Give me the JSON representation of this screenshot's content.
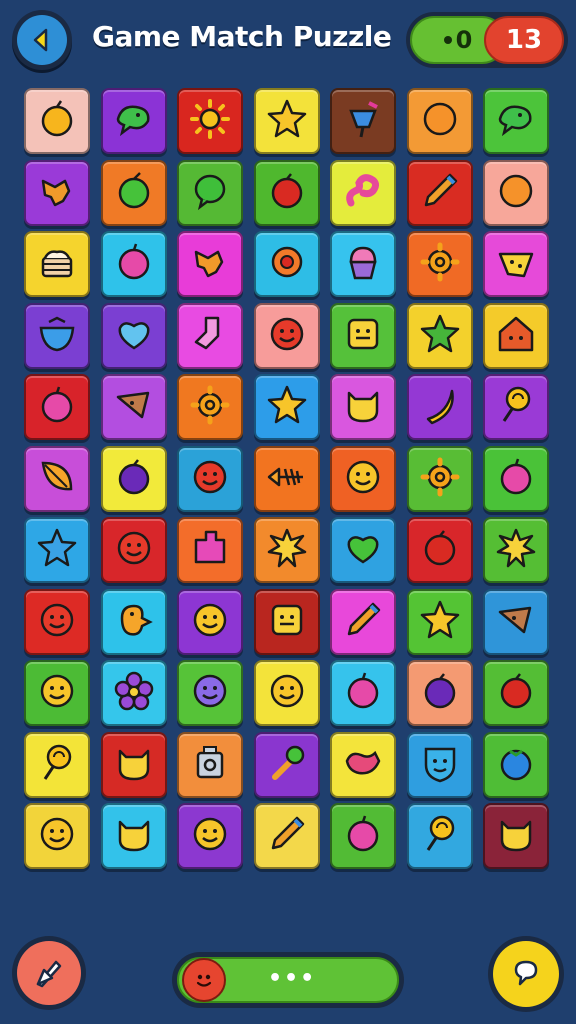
{
  "header": {
    "title": "Game Match Puzzle",
    "score_left": "0",
    "score_right": "13"
  },
  "board": {
    "rows": [
      [
        {
          "bg": "#f4c2b8",
          "icon": "orange-fruit-icon"
        },
        {
          "bg": "#8b33d6",
          "icon": "green-bird-icon"
        },
        {
          "bg": "#d9261f",
          "icon": "sun-icon"
        },
        {
          "bg": "#f3e23a",
          "icon": "star-icon"
        },
        {
          "bg": "#7a3b22",
          "icon": "popsicle-icon"
        },
        {
          "bg": "#f39a35",
          "icon": "orange-blob-icon"
        },
        {
          "bg": "#4cc43a",
          "icon": "green-bird-icon"
        }
      ],
      [
        {
          "bg": "#9a3ad8",
          "icon": "fish-icon"
        },
        {
          "bg": "#f07a26",
          "icon": "green-apple-icon"
        },
        {
          "bg": "#55b934",
          "icon": "green-blob-icon"
        },
        {
          "bg": "#4fb82e",
          "icon": "red-apple-icon"
        },
        {
          "bg": "#e4ec3c",
          "icon": "pink-worm-icon"
        },
        {
          "bg": "#d92c22",
          "icon": "pencil-icon"
        },
        {
          "bg": "#f7a79a",
          "icon": "orange-blob-icon"
        }
      ],
      [
        {
          "bg": "#f5d42d",
          "icon": "cake-icon"
        },
        {
          "bg": "#2fc2ea",
          "icon": "pink-berry-icon"
        },
        {
          "bg": "#e83cd8",
          "icon": "fish-icon"
        },
        {
          "bg": "#2ebde6",
          "icon": "target-icon"
        },
        {
          "bg": "#36c3ee",
          "icon": "cupcake-icon"
        },
        {
          "bg": "#f06a25",
          "icon": "gear-icon"
        },
        {
          "bg": "#e64ad9",
          "icon": "cheese-icon"
        }
      ],
      [
        {
          "bg": "#7b3fd2",
          "icon": "blue-bowl-icon"
        },
        {
          "bg": "#7b3fd2",
          "icon": "blue-heart-icon"
        },
        {
          "bg": "#e84be2",
          "icon": "pink-sock-icon"
        },
        {
          "bg": "#f79c9a",
          "icon": "red-face-icon"
        },
        {
          "bg": "#55c13a",
          "icon": "block-face-icon"
        },
        {
          "bg": "#f3d12c",
          "icon": "green-star-icon"
        },
        {
          "bg": "#f4cb2a",
          "icon": "house-icon"
        }
      ],
      [
        {
          "bg": "#d8232a",
          "icon": "pink-berry-icon"
        },
        {
          "bg": "#b34ee0",
          "icon": "bird-icon"
        },
        {
          "bg": "#f07820",
          "icon": "gear-icon"
        },
        {
          "bg": "#2d9de9",
          "icon": "star-icon"
        },
        {
          "bg": "#d957df",
          "icon": "yellow-cat-icon"
        },
        {
          "bg": "#9438d4",
          "icon": "banana-icon"
        },
        {
          "bg": "#9a3ad6",
          "icon": "lollipop-icon"
        }
      ],
      [
        {
          "bg": "#c84ed9",
          "icon": "leaf-icon"
        },
        {
          "bg": "#f2ea3a",
          "icon": "purple-plum-icon"
        },
        {
          "bg": "#2ba2d8",
          "icon": "red-face-icon"
        },
        {
          "bg": "#f27420",
          "icon": "fish-bone-icon"
        },
        {
          "bg": "#ef6124",
          "icon": "smiley-icon"
        },
        {
          "bg": "#58bd35",
          "icon": "gear-icon"
        },
        {
          "bg": "#4ac238",
          "icon": "pink-berry-icon"
        }
      ],
      [
        {
          "bg": "#2ea7e6",
          "icon": "blue-star-icon"
        },
        {
          "bg": "#d8262a",
          "icon": "red-face-icon"
        },
        {
          "bg": "#f36d2a",
          "icon": "puzzle-icon"
        },
        {
          "bg": "#f28a2c",
          "icon": "burst-icon"
        },
        {
          "bg": "#2fa2e1",
          "icon": "green-heart-icon"
        },
        {
          "bg": "#d8262a",
          "icon": "red-apple-icon"
        },
        {
          "bg": "#55be34",
          "icon": "burst-icon"
        }
      ],
      [
        {
          "bg": "#dd2a25",
          "icon": "red-face-icon"
        },
        {
          "bg": "#2ec2ea",
          "icon": "duck-icon"
        },
        {
          "bg": "#8d36d3",
          "icon": "smiley-icon"
        },
        {
          "bg": "#b9261f",
          "icon": "block-face-icon"
        },
        {
          "bg": "#e848da",
          "icon": "pencil-icon"
        },
        {
          "bg": "#54c434",
          "icon": "star-icon"
        },
        {
          "bg": "#2f95d9",
          "icon": "bird-icon"
        }
      ],
      [
        {
          "bg": "#4cbb35",
          "icon": "smiley-icon"
        },
        {
          "bg": "#35c6eb",
          "icon": "flower-icon"
        },
        {
          "bg": "#56c338",
          "icon": "purple-face-icon"
        },
        {
          "bg": "#f3e33a",
          "icon": "smiley-icon"
        },
        {
          "bg": "#36c3ec",
          "icon": "pink-berry-icon"
        },
        {
          "bg": "#f49a72",
          "icon": "purple-plum-icon"
        },
        {
          "bg": "#54be35",
          "icon": "red-apple-icon"
        }
      ],
      [
        {
          "bg": "#f3e438",
          "icon": "lollipop-icon"
        },
        {
          "bg": "#d62a25",
          "icon": "yellow-cat-icon"
        },
        {
          "bg": "#f28e3c",
          "icon": "robot-icon"
        },
        {
          "bg": "#8a36cf",
          "icon": "wrench-icon"
        },
        {
          "bg": "#f3e43b",
          "icon": "pink-bird-icon"
        },
        {
          "bg": "#2f9ee0",
          "icon": "blue-shield-icon"
        },
        {
          "bg": "#4fbd36",
          "icon": "blue-berry-icon"
        }
      ],
      [
        {
          "bg": "#f2d43a",
          "icon": "smiley-icon"
        },
        {
          "bg": "#33c2ea",
          "icon": "yellow-cat-icon"
        },
        {
          "bg": "#8c38d0",
          "icon": "smiley-icon"
        },
        {
          "bg": "#f3d84a",
          "icon": "pencil-icon"
        },
        {
          "bg": "#52bb35",
          "icon": "pink-berry-icon"
        },
        {
          "bg": "#32a8e0",
          "icon": "lollipop-icon"
        },
        {
          "bg": "#8a2339",
          "icon": "yellow-cat-icon"
        }
      ]
    ]
  },
  "footer": {
    "progress_label": "•••"
  }
}
